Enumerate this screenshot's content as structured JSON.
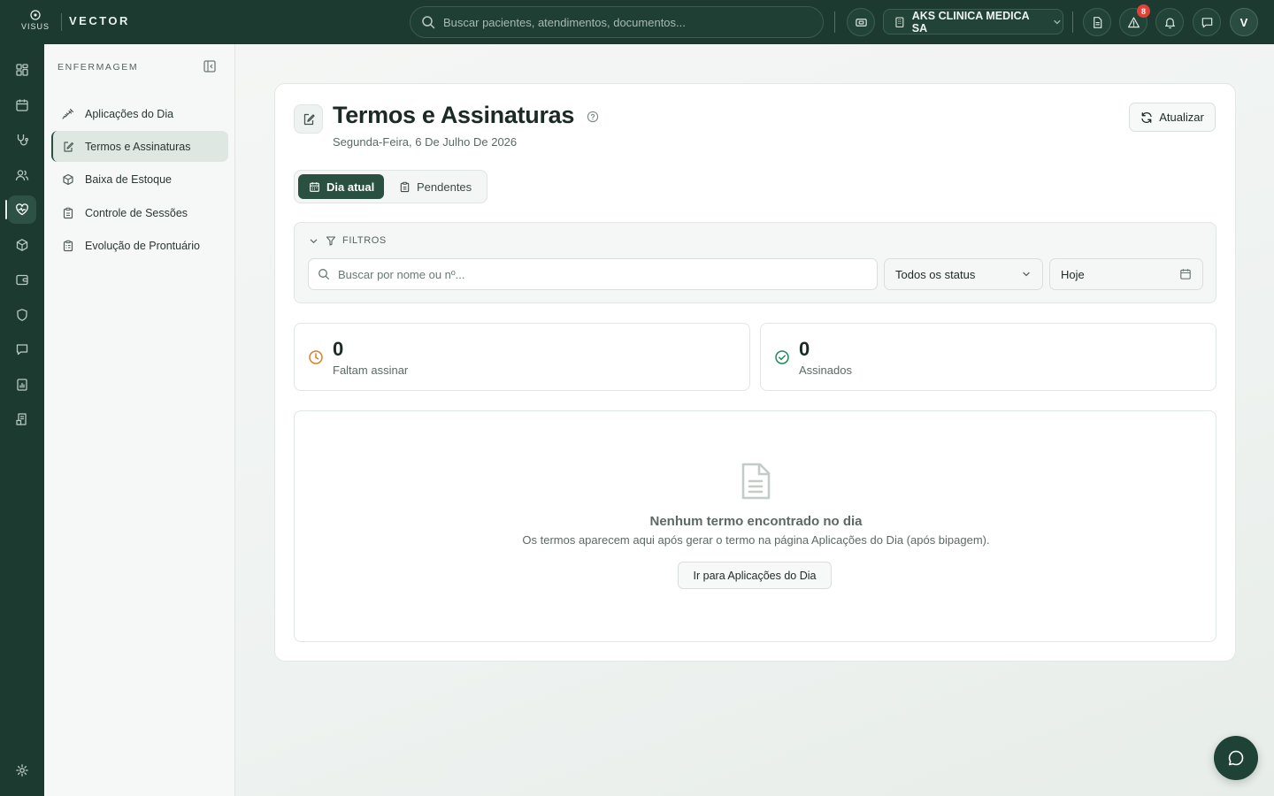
{
  "brand": {
    "logo_text": "VISUS",
    "app_name": "VECTOR"
  },
  "header": {
    "search_placeholder": "Buscar pacientes, atendimentos, documentos...",
    "org_name": "AKS CLINICA MEDICA SA",
    "alerts_count": "8",
    "user_initial": "V"
  },
  "rail": {
    "items": [
      "dashboard-icon",
      "calendar-icon",
      "stethoscope-icon",
      "users-icon",
      "heart-pulse-icon",
      "package-icon",
      "wallet-icon",
      "shield-icon",
      "message-icon",
      "report-icon",
      "billing-icon"
    ],
    "active": "heart-pulse-icon",
    "bottom": "settings-icon"
  },
  "sidebar": {
    "title": "ENFERMAGEM",
    "items": [
      {
        "label": "Aplicações do Dia",
        "icon": "syringe-icon"
      },
      {
        "label": "Termos e Assinaturas",
        "icon": "sign-document-icon",
        "active": true
      },
      {
        "label": "Baixa de Estoque",
        "icon": "package-icon"
      },
      {
        "label": "Controle de Sessões",
        "icon": "clipboard-icon"
      },
      {
        "label": "Evolução de Prontuário",
        "icon": "clipboard-list-icon"
      }
    ]
  },
  "page": {
    "title": "Termos e Assinaturas",
    "date": "Segunda-Feira, 6 De Julho De 2026",
    "refresh_label": "Atualizar"
  },
  "tabs": [
    {
      "label": "Dia atual",
      "active": true
    },
    {
      "label": "Pendentes",
      "active": false
    }
  ],
  "filters": {
    "header": "FILTROS",
    "search_placeholder": "Buscar por nome ou nº...",
    "status_value": "Todos os status",
    "date_value": "Hoje"
  },
  "stats": [
    {
      "value": "0",
      "label": "Faltam assinar",
      "color": "#d9822b"
    },
    {
      "value": "0",
      "label": "Assinados",
      "color": "#1f8a5b"
    }
  ],
  "empty_state": {
    "title": "Nenhum termo encontrado no dia",
    "description": "Os termos aparecem aqui após gerar o termo na página Aplicações do Dia (após bipagem).",
    "button_label": "Ir para Aplicações do Dia"
  },
  "colors": {
    "brand_dark": "#1c3a30",
    "primary": "#2a5042",
    "alert_badge": "#e0423a"
  }
}
